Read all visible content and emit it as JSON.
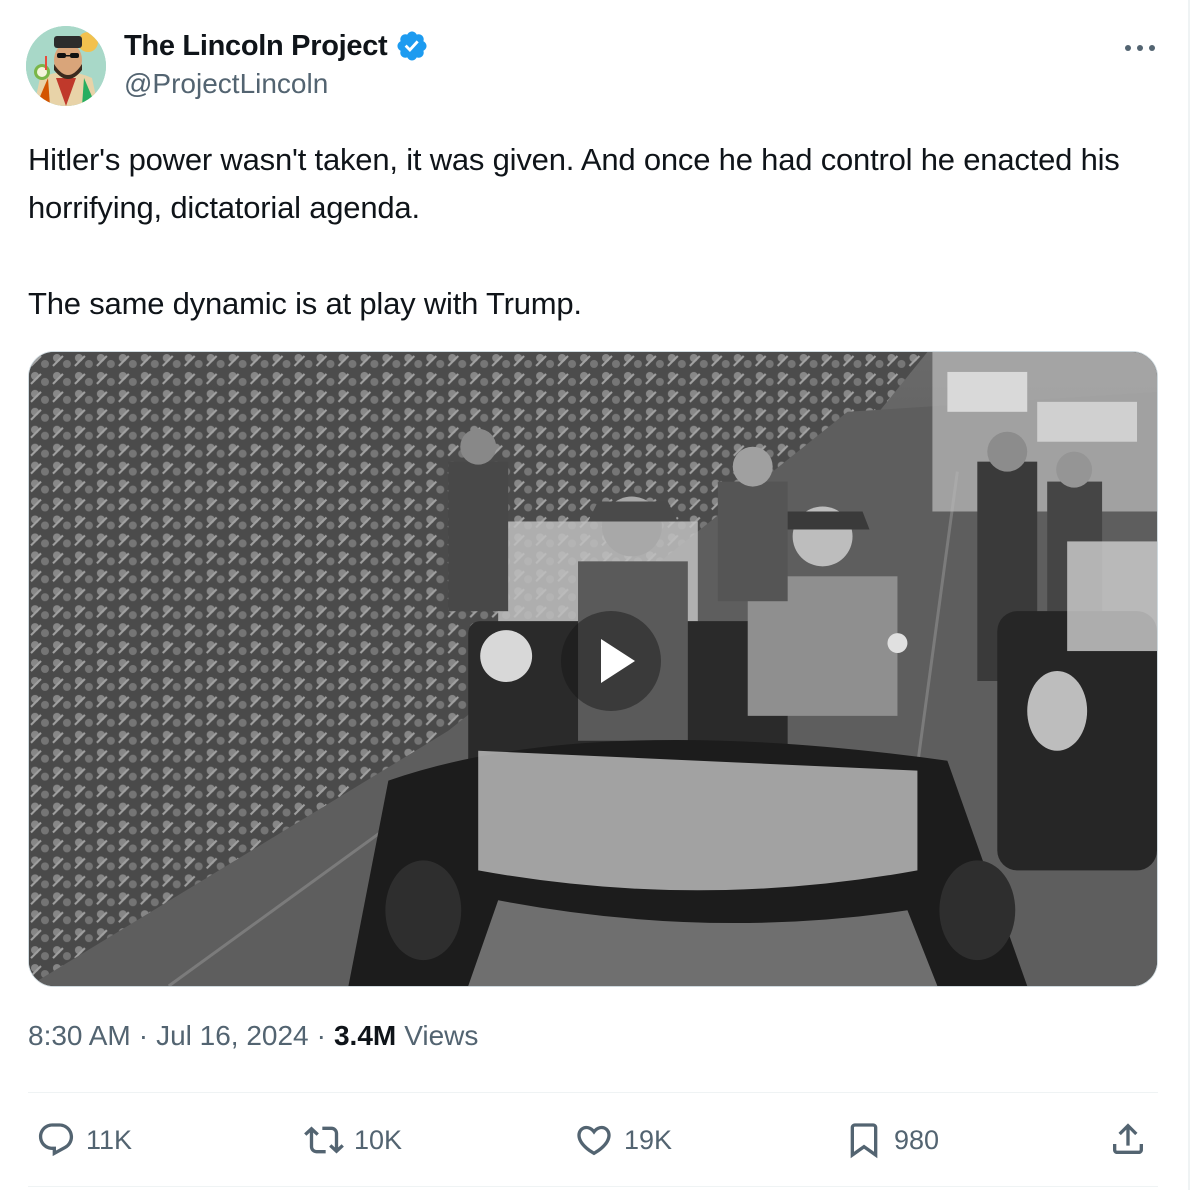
{
  "author": {
    "display_name": "The Lincoln Project",
    "handle": "@ProjectLincoln",
    "verified": true,
    "verified_color": "#1d9bf0"
  },
  "tweet": {
    "text": "Hitler's power wasn't taken, it was given. And once he had control he enacted his horrifying, dictatorial agenda.\n\nThe same dynamic is at play with Trump."
  },
  "media": {
    "type": "video",
    "style": "black-and-white archival footage",
    "play_icon": "play-icon"
  },
  "meta": {
    "time": "8:30 AM",
    "separator": "·",
    "date": "Jul 16, 2024",
    "views_count": "3.4M",
    "views_label": "Views"
  },
  "actions": {
    "reply": {
      "icon": "reply-icon",
      "count": "11K"
    },
    "retweet": {
      "icon": "retweet-icon",
      "count": "10K"
    },
    "like": {
      "icon": "heart-icon",
      "count": "19K"
    },
    "bookmark": {
      "icon": "bookmark-icon",
      "count": "980"
    },
    "share": {
      "icon": "share-icon"
    }
  },
  "colors": {
    "text_primary": "#0f1419",
    "text_secondary": "#536471",
    "divider": "#eff3f4"
  }
}
